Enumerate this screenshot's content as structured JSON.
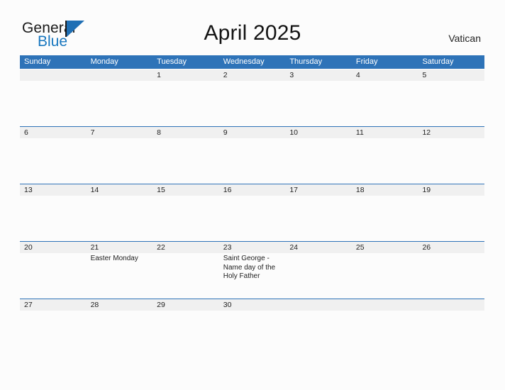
{
  "brand": {
    "word_one": "General",
    "word_two": "Blue",
    "flag_icon": "flag-triangle-icon",
    "accent_color": "#1f6fb4"
  },
  "header": {
    "title": "April 2025",
    "region": "Vatican"
  },
  "theme": {
    "header_blue": "#2e73b8",
    "band_gray": "#f0f0f0",
    "page_background": "#fcfcfc",
    "text": "#1e1e1e"
  },
  "calendar": {
    "weekdays": [
      "Sunday",
      "Monday",
      "Tuesday",
      "Wednesday",
      "Thursday",
      "Friday",
      "Saturday"
    ],
    "weeks": [
      [
        {
          "day": "",
          "events": []
        },
        {
          "day": "",
          "events": []
        },
        {
          "day": "1",
          "events": []
        },
        {
          "day": "2",
          "events": []
        },
        {
          "day": "3",
          "events": []
        },
        {
          "day": "4",
          "events": []
        },
        {
          "day": "5",
          "events": []
        }
      ],
      [
        {
          "day": "6",
          "events": []
        },
        {
          "day": "7",
          "events": []
        },
        {
          "day": "8",
          "events": []
        },
        {
          "day": "9",
          "events": []
        },
        {
          "day": "10",
          "events": []
        },
        {
          "day": "11",
          "events": []
        },
        {
          "day": "12",
          "events": []
        }
      ],
      [
        {
          "day": "13",
          "events": []
        },
        {
          "day": "14",
          "events": []
        },
        {
          "day": "15",
          "events": []
        },
        {
          "day": "16",
          "events": []
        },
        {
          "day": "17",
          "events": []
        },
        {
          "day": "18",
          "events": []
        },
        {
          "day": "19",
          "events": []
        }
      ],
      [
        {
          "day": "20",
          "events": []
        },
        {
          "day": "21",
          "events": [
            "Easter Monday"
          ]
        },
        {
          "day": "22",
          "events": []
        },
        {
          "day": "23",
          "events": [
            "Saint George - Name day of the Holy Father"
          ]
        },
        {
          "day": "24",
          "events": []
        },
        {
          "day": "25",
          "events": []
        },
        {
          "day": "26",
          "events": []
        }
      ],
      [
        {
          "day": "27",
          "events": []
        },
        {
          "day": "28",
          "events": []
        },
        {
          "day": "29",
          "events": []
        },
        {
          "day": "30",
          "events": []
        },
        {
          "day": "",
          "events": []
        },
        {
          "day": "",
          "events": []
        },
        {
          "day": "",
          "events": []
        }
      ]
    ]
  }
}
